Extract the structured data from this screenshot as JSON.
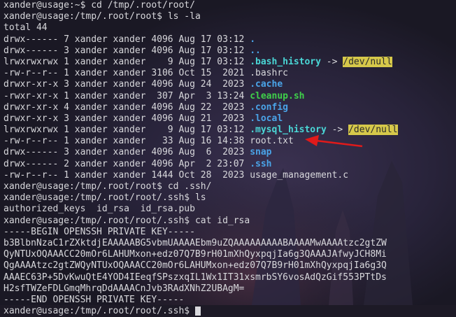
{
  "accent_colors": {
    "directory": "#4aa4e8",
    "symlink": "#4ad6d6",
    "executable": "#3fd04a",
    "null_device_bg": "#d6c84a",
    "arrow": "#e01a1a"
  },
  "terminal": {
    "lines": [
      {
        "prompt": "xander@usage:~$ ",
        "text": "cd /tmp/.root/root/"
      },
      {
        "prompt": "xander@usage:/tmp/.root/root$ ",
        "text": "ls -la"
      },
      {
        "text": "total 44"
      },
      {
        "meta": "drwx------ 7 xander xander 4096 Aug 17 03:12 ",
        "name": ".",
        "kind": "dir"
      },
      {
        "meta": "drwx------ 3 xander xander 4096 Aug 17 03:12 ",
        "name": "..",
        "kind": "dir"
      },
      {
        "meta": "lrwxrwxrwx 1 xander xander    9 Aug 17 03:12 ",
        "name": ".bash_history",
        "kind": "link",
        "arrow": " -> ",
        "target": "/dev/null"
      },
      {
        "meta": "-rw-r--r-- 1 xander xander 3106 Oct 15  2021 ",
        "name": ".bashrc",
        "kind": "file"
      },
      {
        "meta": "drwxr-xr-x 3 xander xander 4096 Aug 24  2023 ",
        "name": ".cache",
        "kind": "dir"
      },
      {
        "meta": "-rwxr-xr-x 1 xander xander  307 Apr  3 13:24 ",
        "name": "cleanup.sh",
        "kind": "exe"
      },
      {
        "meta": "drwxr-xr-x 4 xander xander 4096 Aug 22  2023 ",
        "name": ".config",
        "kind": "dir"
      },
      {
        "meta": "drwxr-xr-x 3 xander xander 4096 Aug 21  2023 ",
        "name": ".local",
        "kind": "dir"
      },
      {
        "meta": "lrwxrwxrwx 1 xander xander    9 Aug 17 03:12 ",
        "name": ".mysql_history",
        "kind": "link",
        "arrow": " -> ",
        "target": "/dev/null"
      },
      {
        "meta": "-rw-r--r-- 1 xander xander   33 Aug 16 14:38 ",
        "name": "root.txt",
        "kind": "file"
      },
      {
        "meta": "drwx------ 3 xander xander 4096 Aug  6  2023 ",
        "name": "snap",
        "kind": "dir"
      },
      {
        "meta": "drwx------ 2 xander xander 4096 Apr  2 23:07 ",
        "name": ".ssh",
        "kind": "dir"
      },
      {
        "meta": "-rw-r--r-- 1 xander xander 1444 Oct 28  2023 ",
        "name": "usage_management.c",
        "kind": "file"
      },
      {
        "prompt": "xander@usage:/tmp/.root/root$ ",
        "text": "cd .ssh/"
      },
      {
        "prompt": "xander@usage:/tmp/.root/root/.ssh$ ",
        "text": "ls"
      },
      {
        "text": "authorized_keys  id_rsa  id_rsa.pub"
      },
      {
        "prompt": "xander@usage:/tmp/.root/root/.ssh$ ",
        "text": "cat id_rsa"
      },
      {
        "text": "-----BEGIN OPENSSH PRIVATE KEY-----"
      },
      {
        "text": "b3BlbnNzaC1rZXktdjEAAAAABG5vbmUAAAAEbm9uZQAAAAAAAAABAAAAMwAAAAtzc2gtZW"
      },
      {
        "text": "QyNTUxOQAAACC20mOr6LAHUMxon+edz07Q7B9rH01mXhQyxpqjIa6g3QAAAJAfwyJCH8Mi"
      },
      {
        "text": "QgAAAAtzc2gtZWQyNTUxOQAAACC20mOr6LAHUMxon+edz07Q7B9rH01mXhQyxpqjIa6g3Q"
      },
      {
        "text": "AAAEC63P+5DvKwuQtE4YOD4IEeqfSPszxqIL1Wx1IT31xsmrbSY6vosAdQzGif553PTtDs"
      },
      {
        "text": "H2sfTWZeFDLGmqMhrqDdAAAACnJvb3RAdXNhZ2UBAgM="
      },
      {
        "text": "-----END OPENSSH PRIVATE KEY-----"
      },
      {
        "prompt": "xander@usage:/tmp/.root/root/.ssh$ ",
        "text": "",
        "cursor": true
      }
    ]
  }
}
